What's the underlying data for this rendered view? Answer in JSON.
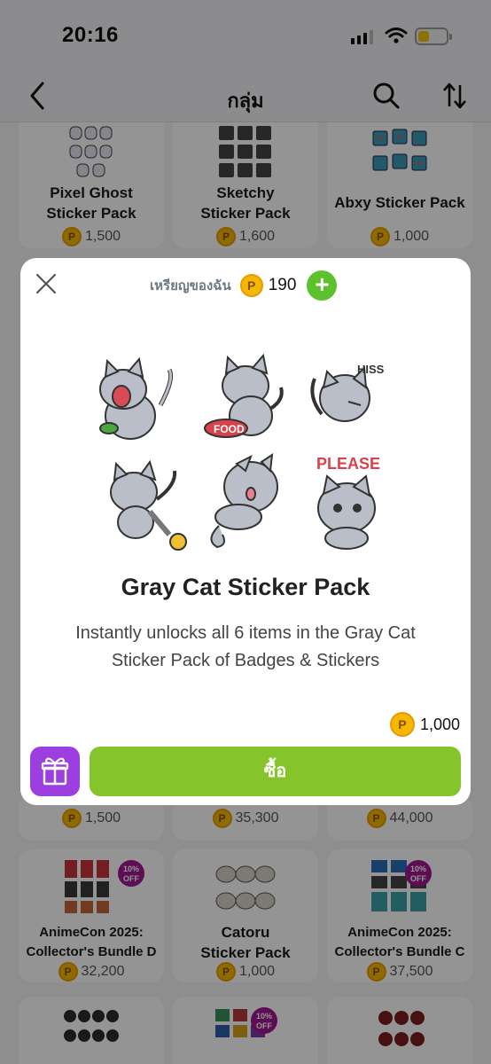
{
  "status_bar": {
    "time": "20:16"
  },
  "nav": {
    "title": "กลุ่ม"
  },
  "cards": [
    {
      "name_line1": "Pixel Ghost",
      "name_line2": "Sticker Pack",
      "price": "1,500",
      "offer": ""
    },
    {
      "name_line1": "Sketchy",
      "name_line2": "Sticker Pack",
      "price": "1,600",
      "offer": ""
    },
    {
      "name_line1": "Abxy Sticker Pack",
      "name_line2": "",
      "price": "1,000",
      "offer": ""
    },
    {
      "name_line1": "",
      "name_line2": "",
      "price": "1,500",
      "offer": ""
    },
    {
      "name_line1": "",
      "name_line2": "",
      "price": "35,300",
      "offer": ""
    },
    {
      "name_line1": "",
      "name_line2": "",
      "price": "44,000",
      "offer": ""
    },
    {
      "name_line1": "AnimeCon 2025:",
      "name_line2": "Collector's Bundle D",
      "price": "32,200",
      "offer": "10% OFF"
    },
    {
      "name_line1": "Catoru",
      "name_line2": "Sticker Pack",
      "price": "1,000",
      "offer": ""
    },
    {
      "name_line1": "AnimeCon 2025:",
      "name_line2": "Collector's Bundle C",
      "price": "37,500",
      "offer": "10% OFF"
    },
    {
      "name_line1": "",
      "name_line2": "",
      "price": "",
      "offer": ""
    },
    {
      "name_line1": "",
      "name_line2": "",
      "price": "",
      "offer": "10% OFF"
    },
    {
      "name_line1": "",
      "name_line2": "",
      "price": "",
      "offer": ""
    }
  ],
  "modal": {
    "coins_label": "เหรียญของฉัน",
    "coins_value": "190",
    "plus_label": "+",
    "title": "Gray Cat Sticker Pack",
    "description": "Instantly unlocks all 6 items in the Gray Cat Sticker Pack of Badges & Stickers",
    "price": "1,000",
    "buy_label": "ซื้อ",
    "sticker_texts": {
      "hiss": "HISS",
      "food": "FOOD",
      "please": "PLEASE"
    }
  },
  "coin_glyph": "P",
  "colors": {
    "buy_button": "#86c42c",
    "gift_button": "#9d3fe0",
    "plus_button": "#5bc12c",
    "coin": "#f4b800",
    "offer_badge": "#a01890"
  },
  "icons": [
    "back-icon",
    "search-icon",
    "sort-icon",
    "close-icon",
    "coin-icon",
    "plus-icon",
    "gift-icon",
    "wifi-icon",
    "battery-icon",
    "signal-icon"
  ]
}
